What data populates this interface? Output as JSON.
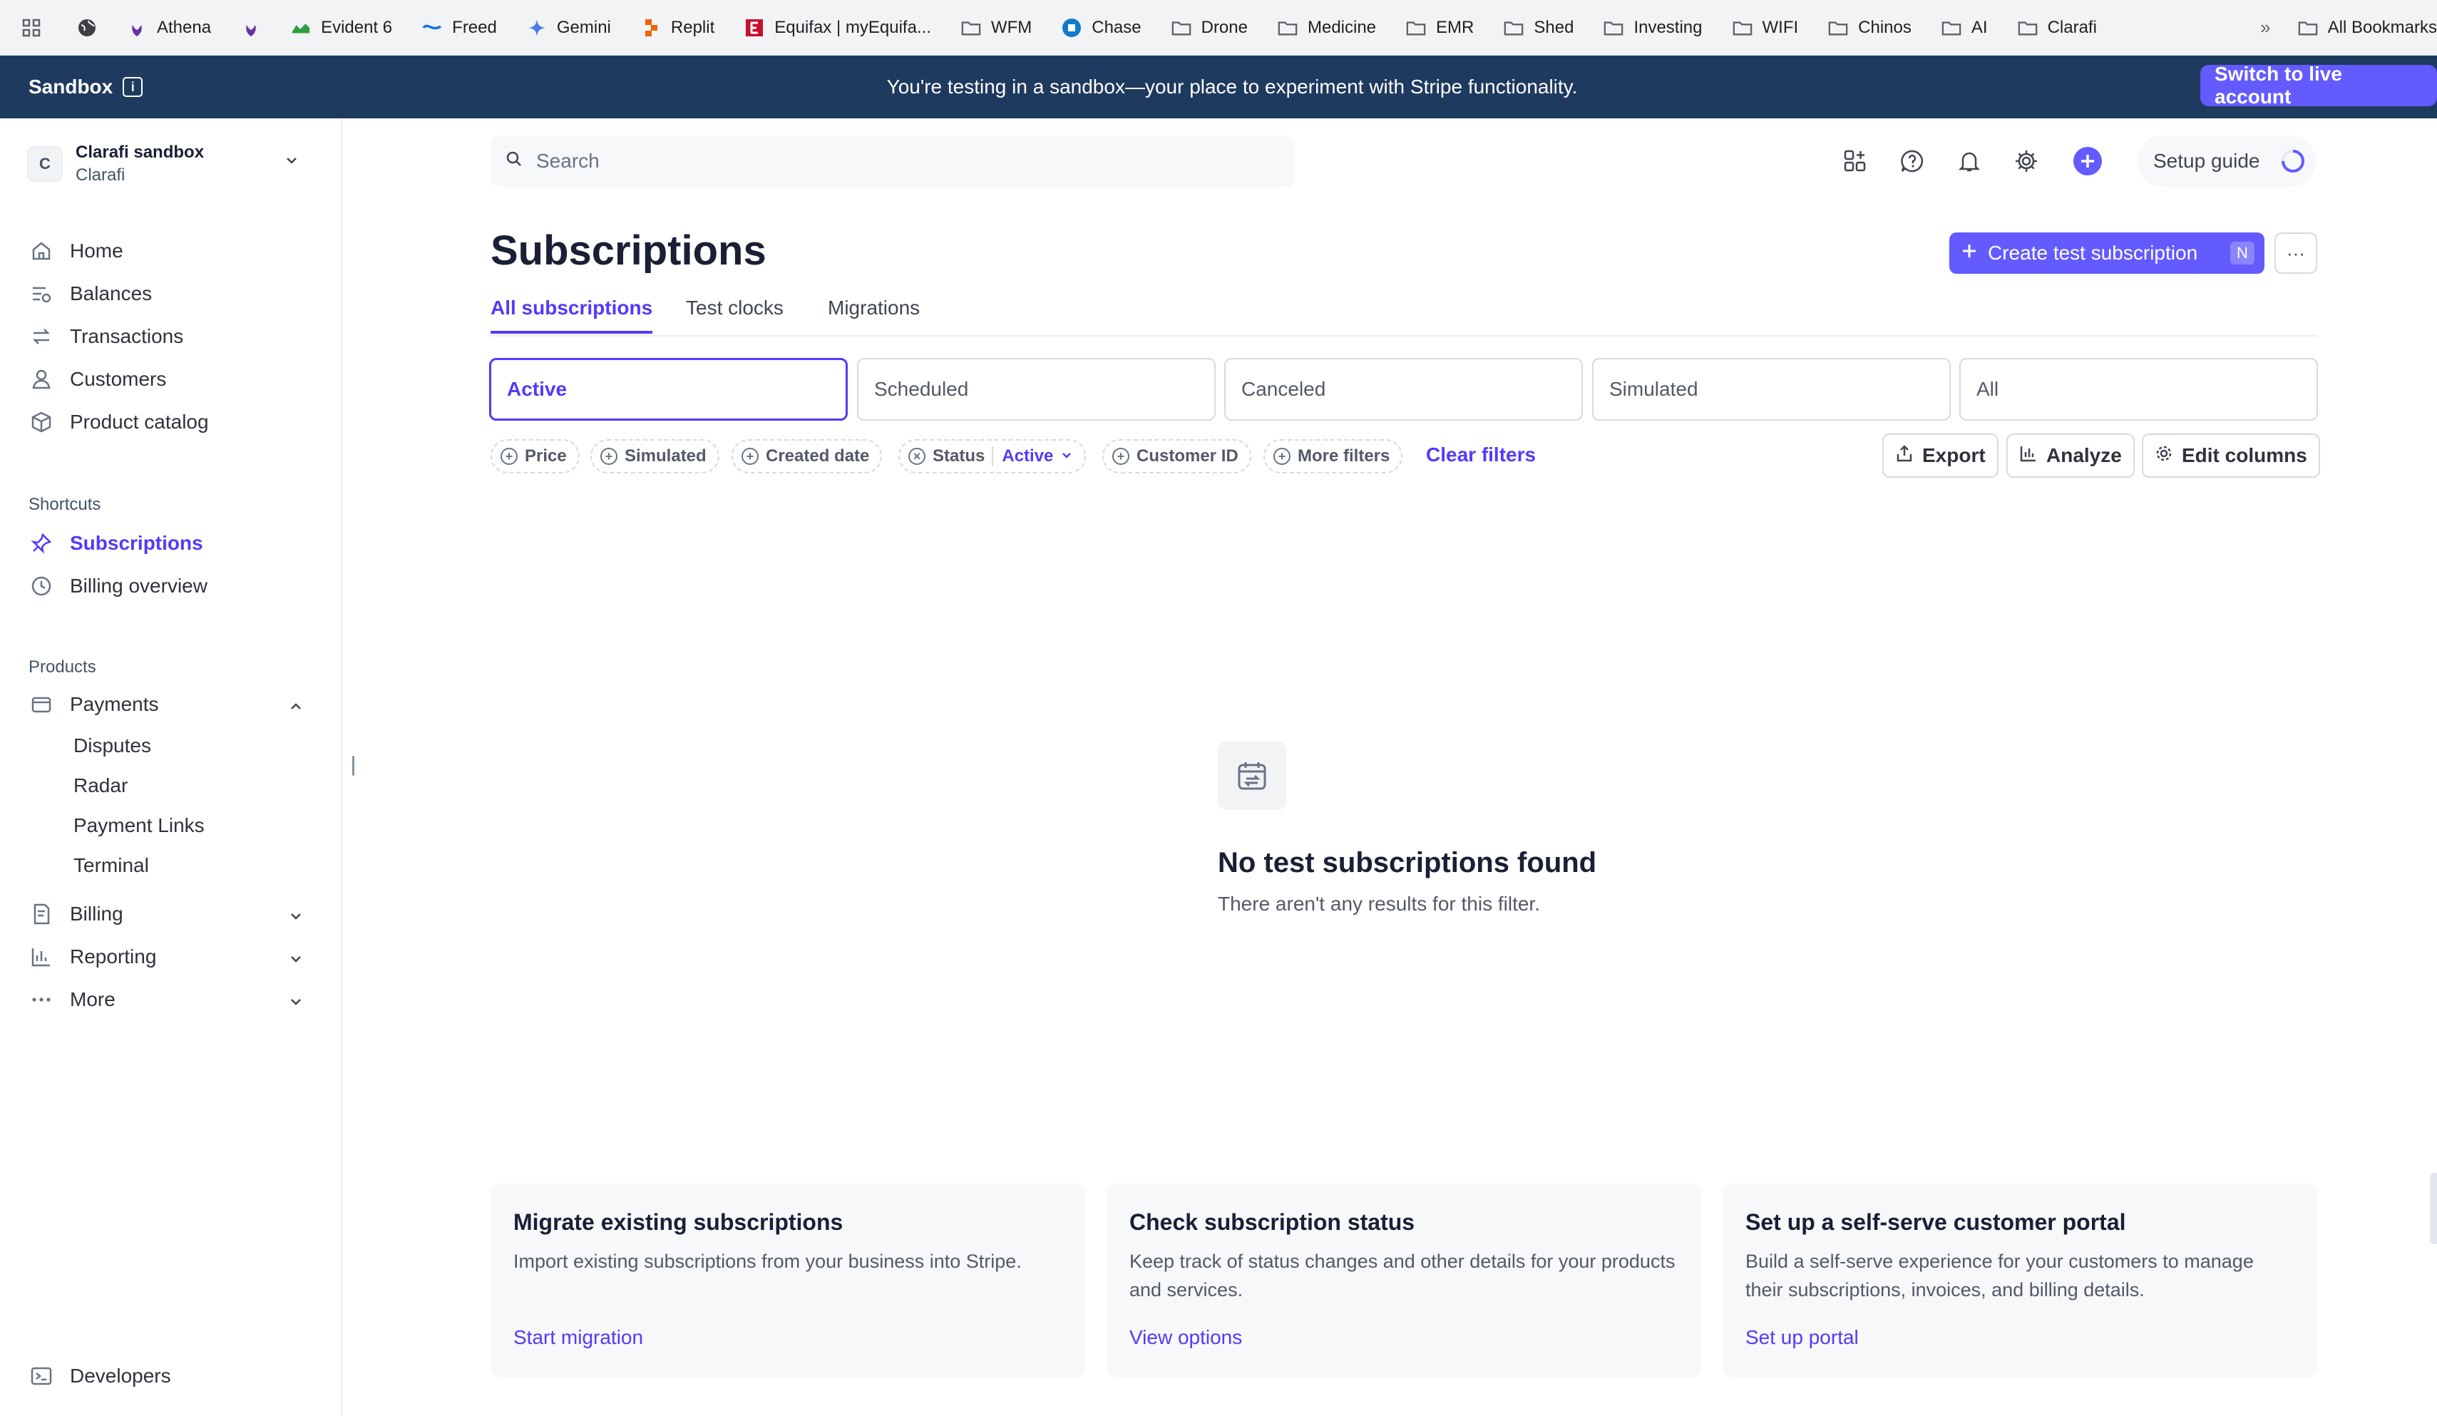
{
  "bookmarks": {
    "items": [
      {
        "label": "",
        "icon": "globe-icon"
      },
      {
        "label": "Athena",
        "icon": "athena-icon"
      },
      {
        "label": "",
        "icon": "athena-icon"
      },
      {
        "label": "Evident 6",
        "icon": "evident-icon"
      },
      {
        "label": "Freed",
        "icon": "freed-icon"
      },
      {
        "label": "Gemini",
        "icon": "gemini-icon"
      },
      {
        "label": "Replit",
        "icon": "replit-icon"
      },
      {
        "label": "Equifax | myEquifa...",
        "icon": "equifax-icon"
      },
      {
        "label": "WFM",
        "icon": "folder-icon"
      },
      {
        "label": "Chase",
        "icon": "chase-icon"
      },
      {
        "label": "Drone",
        "icon": "folder-icon"
      },
      {
        "label": "Medicine",
        "icon": "folder-icon"
      },
      {
        "label": "EMR",
        "icon": "folder-icon"
      },
      {
        "label": "Shed",
        "icon": "folder-icon"
      },
      {
        "label": "Investing",
        "icon": "folder-icon"
      },
      {
        "label": "WIFI",
        "icon": "folder-icon"
      },
      {
        "label": "Chinos",
        "icon": "folder-icon"
      },
      {
        "label": "AI",
        "icon": "folder-icon"
      },
      {
        "label": "Clarafi",
        "icon": "folder-icon"
      }
    ],
    "more": "»",
    "all_bookmarks": "All Bookmarks"
  },
  "banner": {
    "label": "Sandbox",
    "message": "You're testing in a sandbox—your place to experiment with Stripe functionality.",
    "live_button": "Switch to live account"
  },
  "sidebar": {
    "account": {
      "initial": "C",
      "name": "Clarafi sandbox",
      "sub": "Clarafi"
    },
    "main": [
      {
        "label": "Home",
        "icon": "home-icon"
      },
      {
        "label": "Balances",
        "icon": "balances-icon"
      },
      {
        "label": "Transactions",
        "icon": "transactions-icon"
      },
      {
        "label": "Customers",
        "icon": "customers-icon"
      },
      {
        "label": "Product catalog",
        "icon": "product-catalog-icon"
      }
    ],
    "shortcuts_label": "Shortcuts",
    "shortcuts": [
      {
        "label": "Subscriptions",
        "icon": "pin-icon",
        "active": true
      },
      {
        "label": "Billing overview",
        "icon": "clock-icon"
      }
    ],
    "products_label": "Products",
    "payments": {
      "label": "Payments",
      "sub": [
        "Disputes",
        "Radar",
        "Payment Links",
        "Terminal"
      ]
    },
    "billing": "Billing",
    "reporting": "Reporting",
    "more": "More",
    "developers": "Developers"
  },
  "topbar": {
    "search_placeholder": "Search",
    "setup_guide": "Setup guide"
  },
  "page": {
    "title": "Subscriptions",
    "create_button": "Create test subscription",
    "create_shortcut": "N",
    "more_button": "···",
    "tabs": [
      "All subscriptions",
      "Test clocks",
      "Migrations"
    ],
    "status_cards": [
      "Active",
      "Scheduled",
      "Canceled",
      "Simulated",
      "All"
    ],
    "filters": [
      {
        "label": "Price",
        "value": ""
      },
      {
        "label": "Simulated",
        "value": ""
      },
      {
        "label": "Created date",
        "value": ""
      },
      {
        "label": "Status",
        "value": "Active"
      },
      {
        "label": "Customer ID",
        "value": ""
      },
      {
        "label": "More filters",
        "value": ""
      }
    ],
    "clear_filters": "Clear filters",
    "actions": [
      "Export",
      "Analyze",
      "Edit columns"
    ],
    "empty": {
      "title": "No test subscriptions found",
      "subtitle": "There aren't any results for this filter."
    },
    "cards": [
      {
        "title": "Migrate existing subscriptions",
        "body": "Import existing subscriptions from your business into Stripe.",
        "link": "Start migration"
      },
      {
        "title": "Check subscription status",
        "body": "Keep track of status changes and other details for your products and services.",
        "link": "View options"
      },
      {
        "title": "Set up a self-serve customer portal",
        "body": "Build a self-serve experience for your customers to manage their subscriptions, invoices, and billing details.",
        "link": "Set up portal"
      }
    ]
  },
  "colors": {
    "accent": "#635bff",
    "banner": "#1f3a5f",
    "link": "#533afd"
  }
}
